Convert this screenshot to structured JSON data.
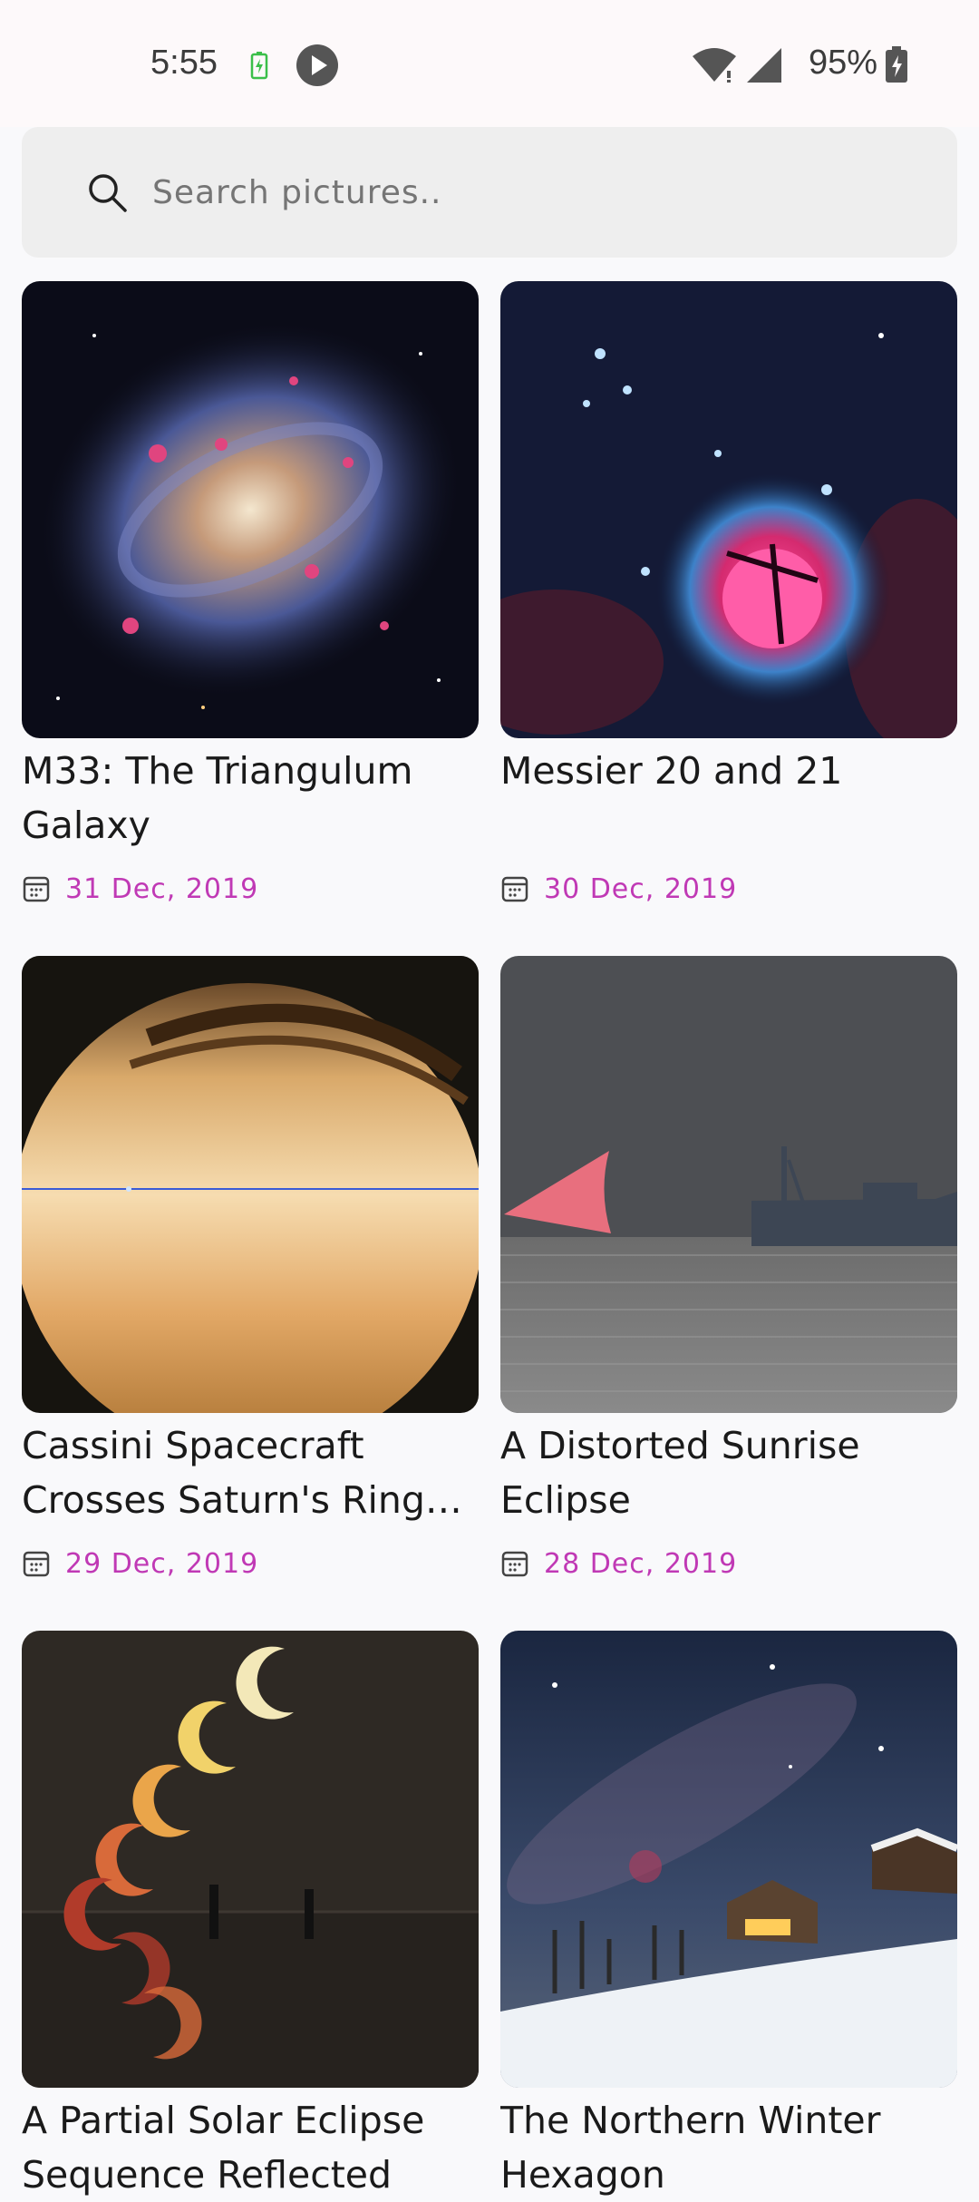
{
  "status_bar": {
    "time": "5:55",
    "battery_percent": "95%",
    "icons": [
      "battery-charging-icon",
      "play-icon",
      "wifi-icon",
      "signal-icon",
      "battery-icon"
    ]
  },
  "search": {
    "placeholder": "Search pictures..",
    "value": "",
    "icon": "search-icon"
  },
  "accent_color": "#c039b5",
  "pictures": [
    {
      "title": "M33: The Triangulum Galaxy",
      "date": "31 Dec, 2019",
      "thumbnail": "triangulum-galaxy-image"
    },
    {
      "title": "Messier 20 and 21",
      "date": "30 Dec, 2019",
      "thumbnail": "trifid-nebula-image"
    },
    {
      "title": "Cassini Spacecraft Crosses Saturn's Ring Plane",
      "date": "29 Dec, 2019",
      "thumbnail": "saturn-image"
    },
    {
      "title": "A Distorted Sunrise Eclipse",
      "date": "28 Dec, 2019",
      "thumbnail": "sunrise-eclipse-image"
    },
    {
      "title": "A Partial Solar Eclipse Sequence Reflected",
      "date": "",
      "thumbnail": "solar-eclipse-sequence-image"
    },
    {
      "title": "The Northern Winter Hexagon",
      "date": "",
      "thumbnail": "winter-hexagon-image"
    }
  ]
}
